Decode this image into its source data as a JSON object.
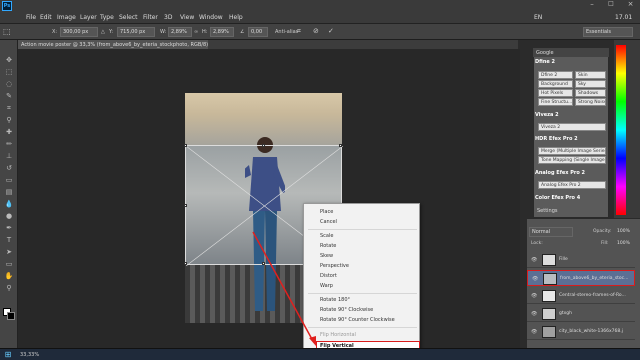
{
  "window": {
    "app_icon": "Ps",
    "brand_color": "#31a8ff"
  },
  "menu": [
    "File",
    "Edit",
    "Image",
    "Layer",
    "Type",
    "Select",
    "Filter",
    "3D",
    "View",
    "Window",
    "Help"
  ],
  "tray": {
    "lang": "EN",
    "time": "17.01",
    "workspace": "Essentials"
  },
  "options": {
    "x_label": "X:",
    "x_value": "300,00 px",
    "y_label": "Y:",
    "y_value": "715,00 px",
    "w_label": "W:",
    "w_value": "2,89%",
    "h_label": "H:",
    "h_value": "2,89%",
    "angle_value": "0,00",
    "antialias": "Anti-alias"
  },
  "document": {
    "tab": "Action movie poster @ 33,3% (from_above6_by_eteria_stockphoto, RGB/8) *"
  },
  "context_menu": {
    "items": [
      "Place",
      "Cancel",
      "Scale",
      "Rotate",
      "Skew",
      "Perspective",
      "Distort",
      "Warp",
      "Rotate 180°",
      "Rotate 90° Clockwise",
      "Rotate 90° Counter Clockwise",
      "Flip Horizontal"
    ],
    "highlighted": "Flip Vertical"
  },
  "plugins": {
    "title": "Google",
    "sections": [
      {
        "name": "Dfine 2",
        "buttons": [
          "Dfine 2",
          "Skin",
          "Background",
          "Sky",
          "Hot Pixels",
          "Shadows",
          "Fine Structu...",
          "Strong Noise"
        ]
      },
      {
        "name": "Viveza 2",
        "buttons": [
          "Viveza 2"
        ]
      },
      {
        "name": "HDR Efex Pro 2",
        "buttons": [
          "Merge (Multiple Image Series)",
          "Tone Mapping (Single Image)"
        ]
      },
      {
        "name": "Analog Efex Pro 2",
        "buttons": [
          "Analog Efex Pro 2"
        ]
      },
      {
        "name": "Color Efex Pro 4",
        "buttons": []
      }
    ],
    "settings": "Settings"
  },
  "layers_panel": {
    "blend_mode": "Normal",
    "opacity_label": "Opacity:",
    "opacity": "100%",
    "lock_label": "Lock:",
    "fill_label": "Fill:",
    "fill": "100%",
    "layers": [
      "Fille",
      "from_above6_by_eteria_stoc...",
      "Central-stereo-frames-of-Ro...",
      "gtxgh",
      "city_black_white-1366x768.j"
    ]
  },
  "status": {
    "zoom": "33,33%"
  }
}
